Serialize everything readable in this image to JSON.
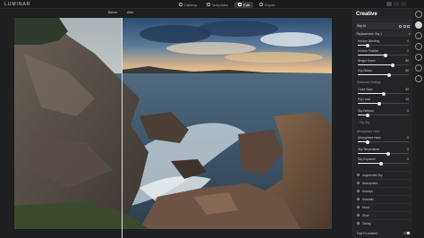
{
  "app": {
    "logo": "LUMINAR"
  },
  "tabs": [
    {
      "label": "Catalog",
      "icon": "catalog-icon",
      "active": false
    },
    {
      "label": "Templates",
      "icon": "templates-icon",
      "active": false
    },
    {
      "label": "Edit",
      "icon": "edit-icon",
      "active": true
    },
    {
      "label": "Export",
      "icon": "export-icon",
      "active": false
    }
  ],
  "compare": {
    "before": "Before",
    "after": "After"
  },
  "panel": {
    "title": "Creative",
    "layer_name": "Sky AI",
    "section": "Replacement: Sky 1",
    "sliders_top": [
      {
        "label": "Horizon Blending",
        "value": "0",
        "level": 0.2
      },
      {
        "label": "Horizon Position",
        "value": "0",
        "level": 0.55
      },
      {
        "label": "Relight Scene",
        "value": "80",
        "level": 0.68
      },
      {
        "label": "Sky Global",
        "value": "60",
        "level": 0.62
      }
    ],
    "group1": "Advanced Settings",
    "sliders_mid": [
      {
        "label": "Close Gaps",
        "value": "50",
        "level": 0.5
      },
      {
        "label": "Sky Local",
        "value": "40",
        "level": 0.42
      },
      {
        "label": "Sky Defocus",
        "value": "0",
        "level": 0.2
      },
      {
        "label": "Flip Sky",
        "value": "",
        "level": null
      }
    ],
    "group2": "Atmosphere Haze",
    "sliders_bottom": [
      {
        "label": "Atmosphere Haze",
        "value": "0",
        "level": 0.2
      },
      {
        "label": "Sky Temperature",
        "value": "0",
        "level": 0.6
      },
      {
        "label": "Sky Exposure",
        "value": "0",
        "level": 0.45
      }
    ],
    "collapsed_sections": [
      "Augmented Sky",
      "Atmosphere",
      "Sunrays",
      "Dramatic",
      "Mood",
      "Glow",
      "Toning"
    ],
    "footer_label": "Fast Fix toolbelt"
  },
  "colors": {
    "accent": "#e9ebee",
    "panel_bg": "#232427",
    "app_bg": "#1e1f21"
  }
}
